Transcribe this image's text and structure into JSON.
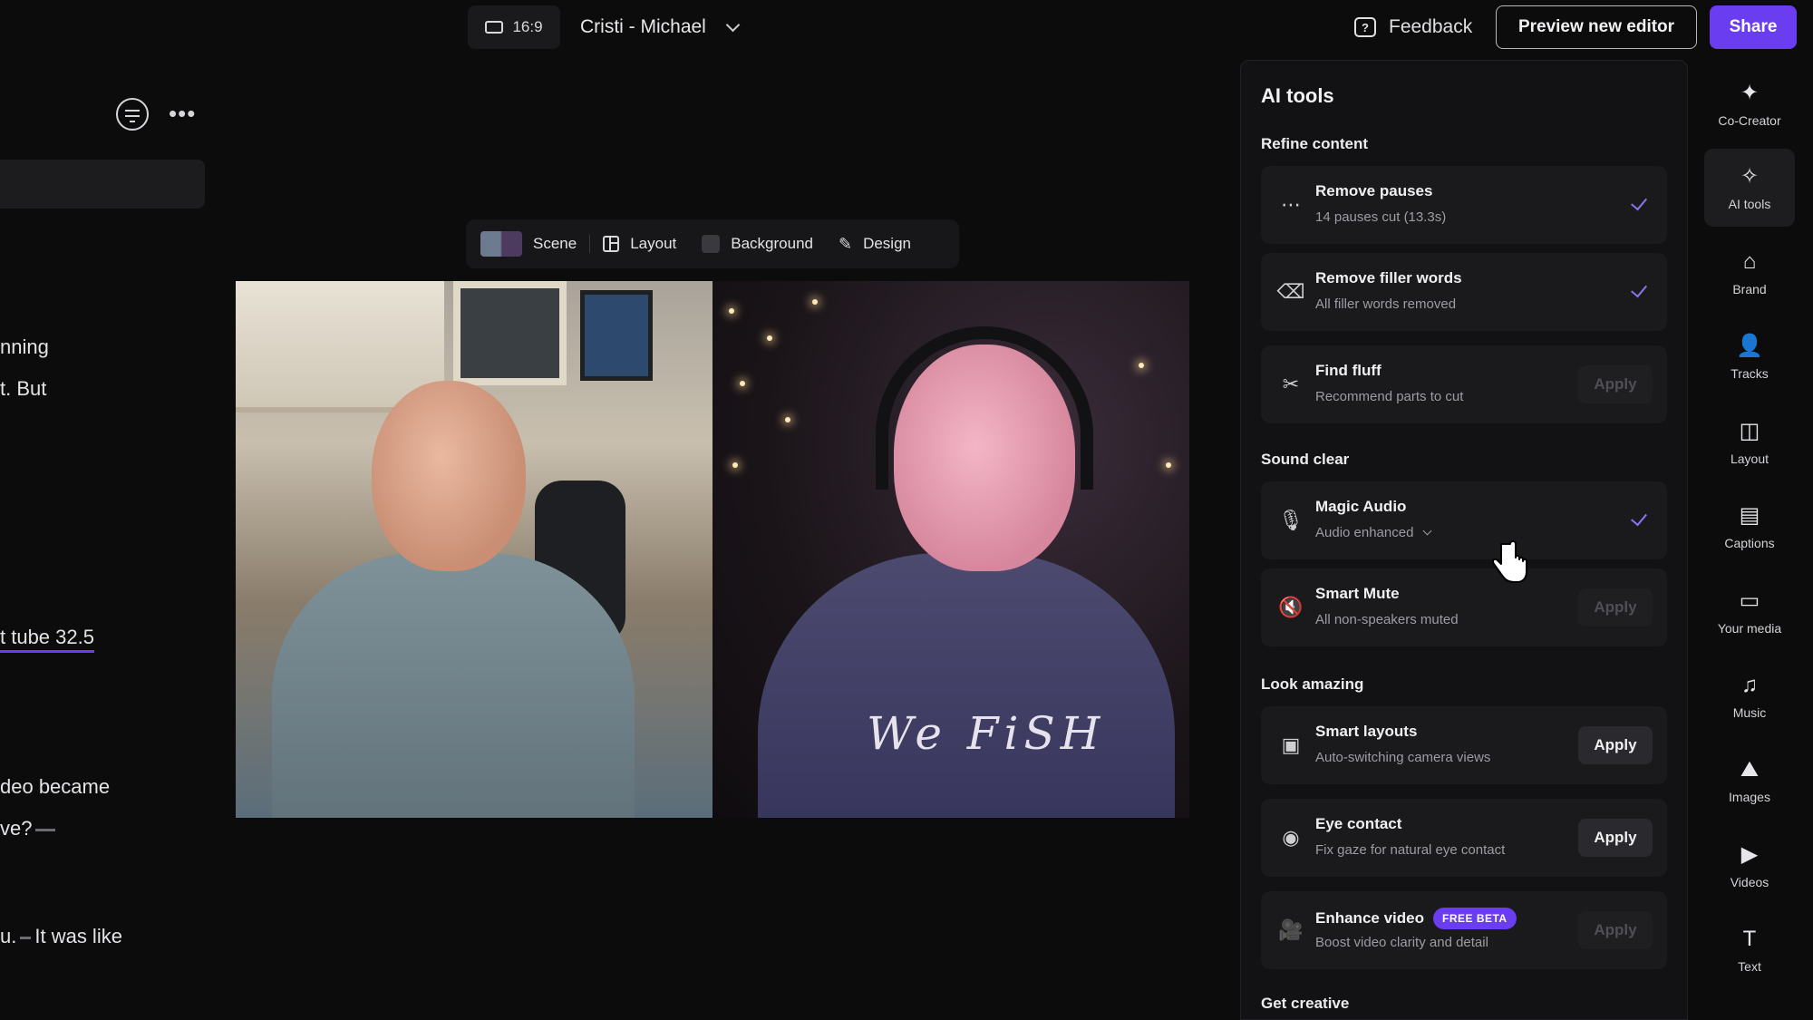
{
  "topbar": {
    "aspect_label": "16:9",
    "project_title": "Cristi - Michael",
    "feedback_label": "Feedback",
    "preview_label": "Preview new editor",
    "share_label": "Share"
  },
  "transcript": {
    "lines": [
      "nning",
      "t. But",
      "t tube 32.5",
      "deo became",
      "ve?",
      "u.",
      "It was like"
    ]
  },
  "scene_toolbar": {
    "scene": "Scene",
    "layout": "Layout",
    "background": "Background",
    "design": "Design"
  },
  "video": {
    "shirt_text": "We FiSH"
  },
  "ai_panel": {
    "title": "AI tools",
    "sections": {
      "refine": "Refine content",
      "sound": "Sound clear",
      "look": "Look amazing",
      "creative": "Get creative"
    },
    "cards": [
      {
        "icon": "remove-pauses-icon",
        "title": "Remove pauses",
        "sub": "14 pauses cut (13.3s)",
        "state": "done"
      },
      {
        "icon": "eraser-icon",
        "title": "Remove filler words",
        "sub": "All filler words removed",
        "state": "done"
      },
      {
        "icon": "find-fluff-icon",
        "title": "Find fluff",
        "sub": "Recommend parts to cut",
        "state": "apply-disabled",
        "apply": "Apply"
      },
      {
        "icon": "magic-audio-icon",
        "title": "Magic Audio",
        "sub": "Audio enhanced",
        "state": "done"
      },
      {
        "icon": "mute-icon",
        "title": "Smart Mute",
        "sub": "All non-speakers muted",
        "state": "apply-disabled",
        "apply": "Apply"
      },
      {
        "icon": "smart-layouts-icon",
        "title": "Smart layouts",
        "sub": "Auto-switching camera views",
        "state": "apply",
        "apply": "Apply"
      },
      {
        "icon": "eye-icon",
        "title": "Eye contact",
        "sub": "Fix gaze for natural eye contact",
        "state": "apply",
        "apply": "Apply"
      },
      {
        "icon": "enhance-video-icon",
        "title": "Enhance video",
        "badge": "FREE BETA",
        "sub": "Boost video clarity and detail",
        "state": "apply-disabled",
        "apply": "Apply"
      }
    ]
  },
  "rail": [
    {
      "icon": "co-creator-icon",
      "label": "Co-Creator"
    },
    {
      "icon": "ai-tools-icon",
      "label": "AI tools"
    },
    {
      "icon": "brand-icon",
      "label": "Brand"
    },
    {
      "icon": "tracks-icon",
      "label": "Tracks"
    },
    {
      "icon": "layout-icon",
      "label": "Layout"
    },
    {
      "icon": "captions-icon",
      "label": "Captions"
    },
    {
      "icon": "folder-icon",
      "label": "Your media"
    },
    {
      "icon": "music-icon",
      "label": "Music"
    },
    {
      "icon": "images-icon",
      "label": "Images"
    },
    {
      "icon": "videos-icon",
      "label": "Videos"
    },
    {
      "icon": "text-icon",
      "label": "Text"
    }
  ],
  "colors": {
    "accent": "#6a3df0",
    "check": "#8a73ee",
    "background": "#0c0c0d",
    "panel": "#121214",
    "card": "#1a1a1d"
  }
}
